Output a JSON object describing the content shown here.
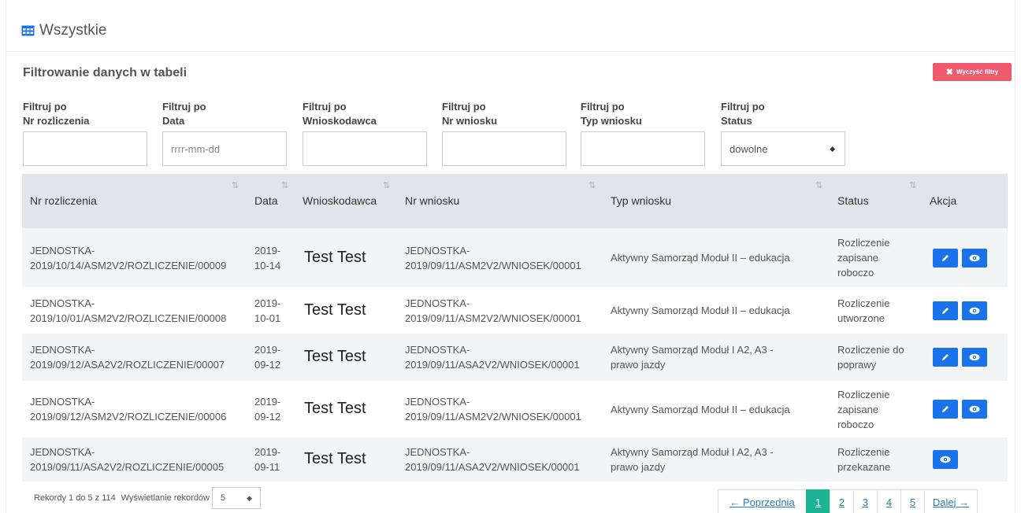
{
  "panel": {
    "title": "Wszystkie"
  },
  "filters": {
    "title": "Filtrowanie danych w tabeli",
    "clear_button": "Wyczyść filtry",
    "items": [
      {
        "line1": "Filtruj po",
        "line2": "Nr rozliczenia",
        "value": "",
        "placeholder": ""
      },
      {
        "line1": "Filtruj po",
        "line2": "Data",
        "value": "",
        "placeholder": "rrrr-mm-dd"
      },
      {
        "line1": "Filtruj po",
        "line2": "Wnioskodawca",
        "value": "",
        "placeholder": ""
      },
      {
        "line1": "Filtruj po",
        "line2": "Nr wniosku",
        "value": "",
        "placeholder": ""
      },
      {
        "line1": "Filtruj po",
        "line2": "Typ wniosku",
        "value": "",
        "placeholder": ""
      },
      {
        "line1": "Filtruj po",
        "line2": "Status",
        "value": "dowolne",
        "placeholder": ""
      }
    ]
  },
  "table": {
    "columns": [
      "Nr rozliczenia",
      "Data",
      "Wnioskodawca",
      "Nr wniosku",
      "Typ wniosku",
      "Status",
      "Akcja"
    ],
    "sort_icon": "⇅",
    "rows": [
      {
        "nr_1": "JEDNOSTKA-",
        "nr_2": "2019/10/14/ASM2V2/ROZLICZENIE/00009",
        "data_1": "2019-",
        "data_2": "10-14",
        "applicant": "Test Test",
        "wn_1": "JEDNOSTKA-",
        "wn_2": "2019/09/11/ASM2V2/WNIOSEK/00001",
        "typ_1": "Aktywny Samorząd Moduł II – edukacja",
        "typ_2": "",
        "status": [
          "Rozliczenie",
          "zapisane",
          "roboczo"
        ],
        "edit": true
      },
      {
        "nr_1": "JEDNOSTKA-",
        "nr_2": "2019/10/01/ASM2V2/ROZLICZENIE/00008",
        "data_1": "2019-",
        "data_2": "10-01",
        "applicant": "Test Test",
        "wn_1": "JEDNOSTKA-",
        "wn_2": "2019/09/11/ASM2V2/WNIOSEK/00001",
        "typ_1": "Aktywny Samorząd Moduł II – edukacja",
        "typ_2": "",
        "status": [
          "Rozliczenie",
          "utworzone"
        ],
        "edit": true
      },
      {
        "nr_1": "JEDNOSTKA-",
        "nr_2": "2019/09/12/ASA2V2/ROZLICZENIE/00007",
        "data_1": "2019-",
        "data_2": "09-12",
        "applicant": "Test Test",
        "wn_1": "JEDNOSTKA-",
        "wn_2": "2019/09/11/ASA2V2/WNIOSEK/00001",
        "typ_1": "Aktywny Samorząd Moduł I A2, A3 -",
        "typ_2": "prawo jazdy",
        "status": [
          "Rozliczenie do",
          "poprawy"
        ],
        "edit": true
      },
      {
        "nr_1": "JEDNOSTKA-",
        "nr_2": "2019/09/12/ASM2V2/ROZLICZENIE/00006",
        "data_1": "2019-",
        "data_2": "09-12",
        "applicant": "Test Test",
        "wn_1": "JEDNOSTKA-",
        "wn_2": "2019/09/11/ASM2V2/WNIOSEK/00001",
        "typ_1": "Aktywny Samorząd Moduł II – edukacja",
        "typ_2": "",
        "status": [
          "Rozliczenie",
          "zapisane",
          "roboczo"
        ],
        "edit": true
      },
      {
        "nr_1": "JEDNOSTKA-",
        "nr_2": "2019/09/11/ASA2V2/ROZLICZENIE/00005",
        "data_1": "2019-",
        "data_2": "09-11",
        "applicant": "Test Test",
        "wn_1": "JEDNOSTKA-",
        "wn_2": "2019/09/11/ASA2V2/WNIOSEK/00001",
        "typ_1": "Aktywny Samorząd Moduł I A2, A3 -",
        "typ_2": "prawo jazdy",
        "status": [
          "Rozliczenie",
          "przekazane"
        ],
        "edit": false
      }
    ]
  },
  "footer": {
    "records_info": "Rekordy 1 do 5 z 114",
    "per_page_label": "Wyświetlanie rekordów",
    "per_page_value": "5",
    "prev": "← Poprzednia",
    "pages": [
      "1",
      "2",
      "3",
      "4",
      "5"
    ],
    "active_page": "1",
    "next": "Dalej →"
  },
  "colors": {
    "accent": "#1ab394",
    "danger": "#ef5a6f",
    "action": "#1a73e8",
    "header_bg": "#dfe5ea"
  }
}
